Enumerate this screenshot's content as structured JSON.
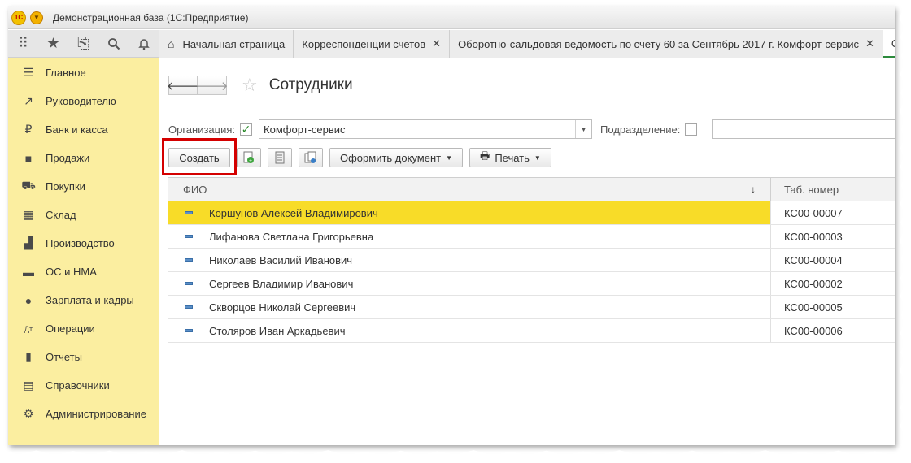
{
  "window": {
    "title": "Демонстрационная база  (1С:Предприятие)",
    "logo_text": "1С"
  },
  "toolbar_icons": [
    "apps-grid-icon",
    "star-icon",
    "history-icon",
    "search-icon",
    "bell-icon"
  ],
  "tabs": [
    {
      "label": "Начальная страница",
      "closable": false,
      "icon": "home-icon"
    },
    {
      "label": "Корреспонденции счетов",
      "closable": true
    },
    {
      "label": "Оборотно-сальдовая ведомость по счету 60 за Сентябрь 2017 г. Комфорт-сервис",
      "closable": true
    },
    {
      "label": "Со",
      "closable": false,
      "active": true
    }
  ],
  "sidebar": {
    "items": [
      {
        "label": "Главное",
        "icon": "menu-lines-icon"
      },
      {
        "label": "Руководителю",
        "icon": "trend-icon"
      },
      {
        "label": "Банк и касса",
        "icon": "ruble-coin-icon"
      },
      {
        "label": "Продажи",
        "icon": "shopping-bag-icon"
      },
      {
        "label": "Покупки",
        "icon": "cart-icon"
      },
      {
        "label": "Склад",
        "icon": "warehouse-icon"
      },
      {
        "label": "Производство",
        "icon": "factory-icon"
      },
      {
        "label": "ОС и НМА",
        "icon": "truck-icon"
      },
      {
        "label": "Зарплата и кадры",
        "icon": "person-icon"
      },
      {
        "label": "Операции",
        "icon": "dt-kt-icon"
      },
      {
        "label": "Отчеты",
        "icon": "bar-chart-icon"
      },
      {
        "label": "Справочники",
        "icon": "books-icon"
      },
      {
        "label": "Администрирование",
        "icon": "gear-icon"
      }
    ]
  },
  "page": {
    "title": "Сотрудники",
    "org_label": "Организация:",
    "org_checked": true,
    "org_value": "Комфорт-сервис",
    "division_label": "Подразделение:",
    "division_checked": false,
    "division_value": ""
  },
  "toolbar": {
    "create": "Создать",
    "make_document": "Оформить документ",
    "print": "Печать"
  },
  "table": {
    "columns": [
      "ФИО",
      "Таб. номер"
    ],
    "rows": [
      {
        "name": "Коршунов Алексей Владимирович",
        "tab": "КС00-00007",
        "selected": true
      },
      {
        "name": "Лифанова Светлана Григорьевна",
        "tab": "КС00-00003"
      },
      {
        "name": "Николаев Василий Иванович",
        "tab": "КС00-00004"
      },
      {
        "name": "Сергеев Владимир Иванович",
        "tab": "КС00-00002"
      },
      {
        "name": "Скворцов Николай Сергеевич",
        "tab": "КС00-00005"
      },
      {
        "name": "Столяров Иван Аркадьевич",
        "tab": "КС00-00006"
      }
    ]
  },
  "colors": {
    "sidebar": "#fbeea0",
    "selected_row": "#f8dc28",
    "highlight": "#d40000",
    "active_tab": "#2c8a3c"
  }
}
